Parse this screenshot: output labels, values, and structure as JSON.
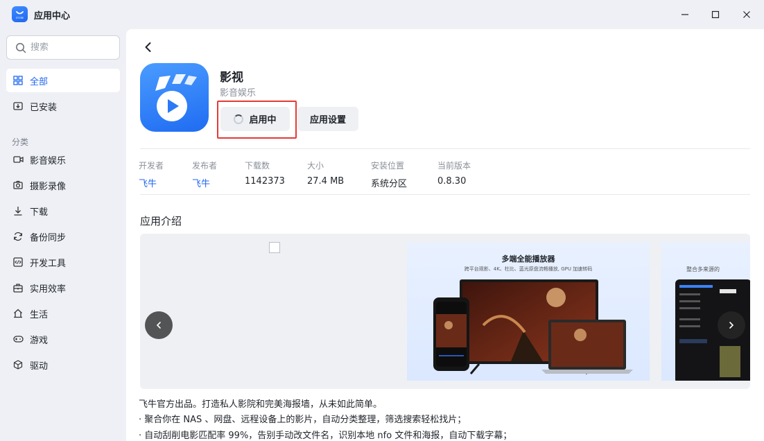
{
  "window": {
    "title": "应用中心",
    "logo_text": "STORE"
  },
  "search": {
    "placeholder": "搜索"
  },
  "sidebar": {
    "top_items": [
      {
        "label": "全部",
        "icon": "grid-icon",
        "active": true
      },
      {
        "label": "已安装",
        "icon": "installed-icon",
        "active": false
      }
    ],
    "section_label": "分类",
    "categories": [
      {
        "label": "影音娱乐",
        "icon": "video-camera-icon"
      },
      {
        "label": "摄影录像",
        "icon": "camera-icon"
      },
      {
        "label": "下载",
        "icon": "download-icon"
      },
      {
        "label": "备份同步",
        "icon": "sync-icon"
      },
      {
        "label": "开发工具",
        "icon": "code-icon"
      },
      {
        "label": "实用效率",
        "icon": "toolbox-icon"
      },
      {
        "label": "生活",
        "icon": "home-icon"
      },
      {
        "label": "游戏",
        "icon": "gamepad-icon"
      },
      {
        "label": "驱动",
        "icon": "cube-icon"
      }
    ]
  },
  "app": {
    "name": "影视",
    "category": "影音娱乐",
    "primary_button": "启用中",
    "secondary_button": "应用设置",
    "meta": [
      {
        "key": "开发者",
        "value": "飞牛",
        "link": true
      },
      {
        "key": "发布者",
        "value": "飞牛",
        "link": true
      },
      {
        "key": "下载数",
        "value": "1142373",
        "link": false
      },
      {
        "key": "大小",
        "value": "27.4 MB",
        "link": false
      },
      {
        "key": "安装位置",
        "value": "系统分区",
        "link": false
      },
      {
        "key": "当前版本",
        "value": "0.8.30",
        "link": false
      }
    ]
  },
  "intro": {
    "title": "应用介绍",
    "screenshot1": {
      "heading": "多端全能播放器",
      "subheading": "跨平台观影、4K、杜比、蓝光原盘流畅播放, GPU 加速转码"
    },
    "screenshot2": {
      "subheading": "整合多来源的"
    },
    "description": [
      "飞牛官方出品。打造私人影院和完美海报墙，从未如此简单。",
      "· 聚合你在 NAS 、网盘、远程设备上的影片，自动分类整理，筛选搜索轻松找片；",
      "· 自动刮削电影匹配率 99%，告别手动改文件名，识别本地 nfo 文件和海报，自动下载字幕；"
    ]
  },
  "colors": {
    "accent": "#1f66f0",
    "highlight": "#e53935"
  }
}
